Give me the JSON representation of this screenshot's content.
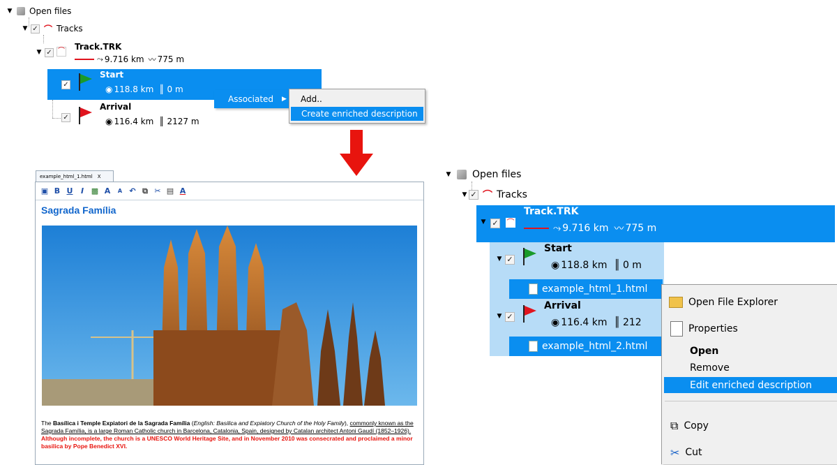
{
  "top_tree": {
    "root_label": "Open files",
    "tracks_label": "Tracks",
    "track_name": "Track.TRK",
    "track_distance": "9.716 km",
    "track_elevation": "775 m",
    "start_label": "Start",
    "start_distance": "118.8 km",
    "start_altitude": "0 m",
    "arrival_label": "Arrival",
    "arrival_distance": "116.4 km",
    "arrival_altitude": "2127 m"
  },
  "context_menu_1": {
    "associated_label": "Associated",
    "submenu": [
      "Add..",
      "Create enriched description"
    ]
  },
  "editor": {
    "tab_label": "example_html_1.html",
    "tab_close": "X",
    "toolbar": [
      "save",
      "bold",
      "underline",
      "italic",
      "image",
      "font-size-up",
      "font-size-down",
      "undo",
      "copy",
      "cut",
      "paste",
      "font-color"
    ],
    "heading": "Sagrada Família",
    "para_1": "The ",
    "para_bold": "Basílica i Temple Expiatori de la Sagrada Família",
    "para_2": " (",
    "para_italic": "English: Basilica and Expiatory Church of the Holy Family",
    "para_3": "),",
    "para_underline": "commonly known as the Sagrada Família, is a large Roman Catholic church in Barcelona, Catalonia, Spain, designed by Catalan architect Antoni Gaudí (1852–1926).",
    "para_red": " Although incomplete, the church is a UNESCO World Heritage Site, and in November 2010 was consecrated and proclaimed a minor basilica by Pope Benedict XVI."
  },
  "right_tree": {
    "root_label": "Open files",
    "tracks_label": "Tracks",
    "track_name": "Track.TRK",
    "track_distance": "9.716 km",
    "track_elevation": "775 m",
    "start_label": "Start",
    "start_distance": "118.8 km",
    "start_altitude": "0 m",
    "file_1": "example_html_1.html",
    "arrival_label": "Arrival",
    "arrival_distance": "116.4 km",
    "arrival_altitude": "212",
    "file_2": "example_html_2.html"
  },
  "context_menu_2": {
    "items": [
      "Open File Explorer",
      "Properties",
      "Open",
      "Remove",
      "Edit enriched description",
      "Copy",
      "Cut"
    ]
  },
  "colors": {
    "selection": "#0a8ef0",
    "selection_light": "#b7dcf7",
    "arrow": "#e8140e",
    "heading": "#1166cc",
    "red_text": "#e8140e"
  }
}
